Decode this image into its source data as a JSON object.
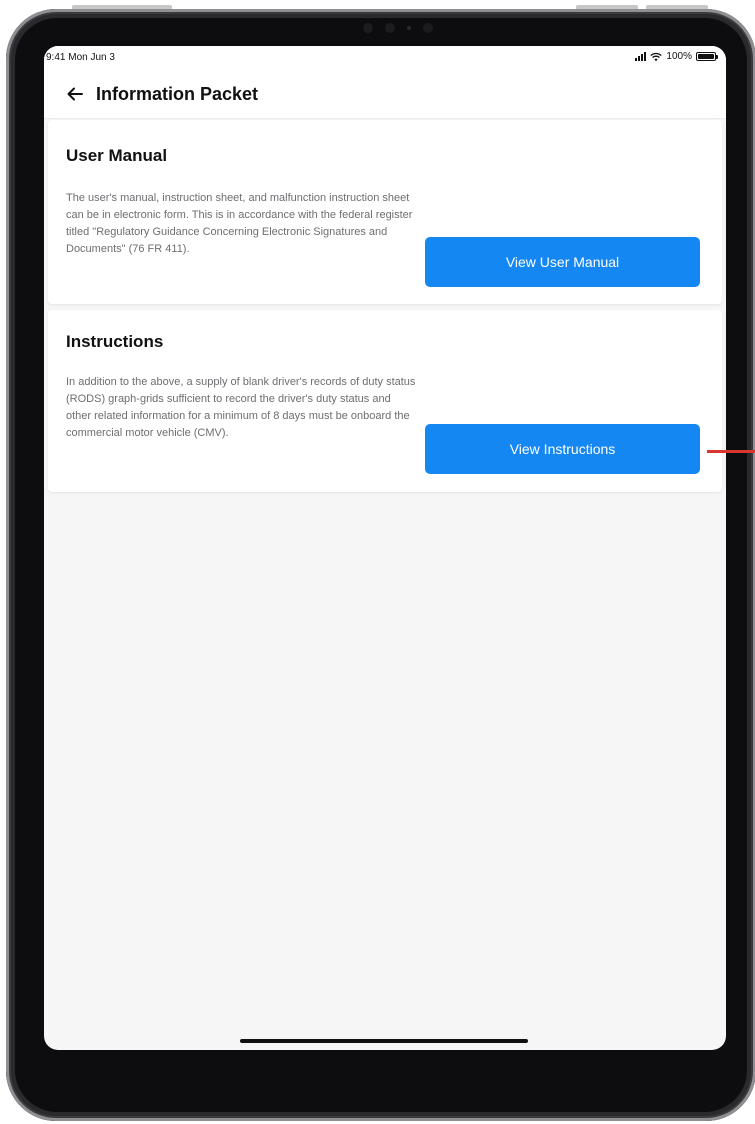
{
  "status": {
    "time": "9:41 Mon Jun 3",
    "battery_percent": "100%",
    "signal_icon": "signal-bars-icon",
    "wifi_icon": "wifi-icon",
    "battery_icon": "battery-icon"
  },
  "header": {
    "back_icon": "arrow-left-icon",
    "title": "Information Packet"
  },
  "cards": [
    {
      "title": "User Manual",
      "body": "The user's manual, instruction sheet, and malfunction instruction sheet can be in electronic form. This is in accordance with the federal register titled \"Regulatory Guidance Concerning Electronic Signatures and Documents\" (76 FR 411).",
      "button_label": "View User Manual"
    },
    {
      "title": "Instructions",
      "body": "In addition to the above, a supply of blank driver's records of duty status (RODS) graph-grids sufficient to record the driver's duty status and other related information for a minimum of 8 days must be onboard the commercial motor vehicle (CMV).",
      "button_label": "View Instructions"
    }
  ],
  "colors": {
    "accent": "#1487f3",
    "background": "#f6f6f7",
    "card": "#ffffff",
    "annotation": "#d9362f"
  }
}
